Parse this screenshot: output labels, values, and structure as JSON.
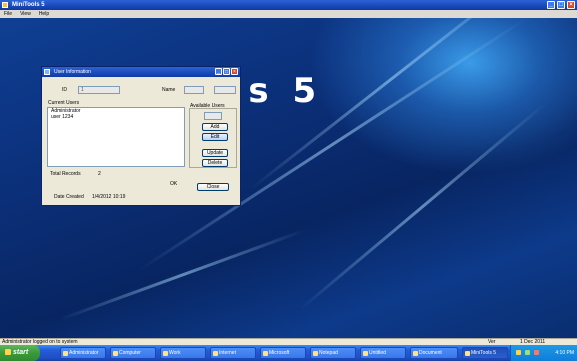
{
  "app": {
    "title": "MiniTools 5"
  },
  "menu": [
    "File",
    "View",
    "Help"
  ],
  "desktop": {
    "brand_text": "MiniTools 5"
  },
  "dialog": {
    "title": "User Information",
    "field1_label": "ID",
    "field1_value": "1",
    "field2_label": "Name",
    "field2_value": "",
    "field3_value": "",
    "list_label": "Current Users",
    "list_items": [
      "Administrator",
      "user 1234"
    ],
    "group_label": "Available Users",
    "group_field_value": "",
    "btn1": "Add",
    "btn2": "Edit",
    "btn3": "Update",
    "btn4": "Delete",
    "count_label": "Total Records",
    "count_value": "2",
    "ok_label": "OK",
    "close_label": "Close",
    "footer_label": "Date Created",
    "footer_value": "1/4/2012 10:19"
  },
  "status": {
    "left": "Administrator logged on to system",
    "r1": "Ver",
    "r2": "1 Dec 2011"
  },
  "taskbar": {
    "start": "start",
    "items": [
      "Administrator",
      "Computer",
      "Work",
      "Internet",
      "Microsoft",
      "Notepad",
      "Untitled",
      "Document",
      "MiniTools 5"
    ],
    "clock": "4:10 PM"
  },
  "colors": {
    "titlebar": "#245edb",
    "desktop": "#0a2a6b",
    "start": "#3a9a3a",
    "tray": "#0f7dd8"
  }
}
